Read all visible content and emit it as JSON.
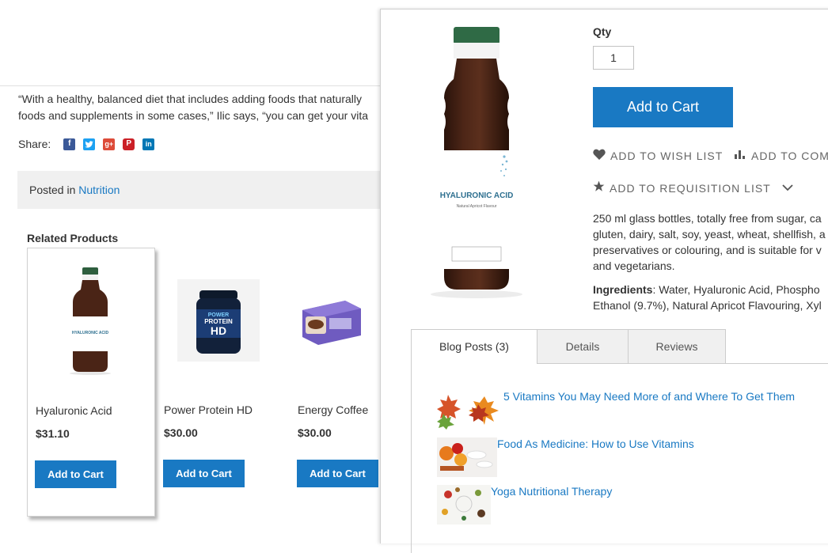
{
  "blog": {
    "quote_line1": "“With a healthy, balanced diet that includes adding foods that naturally",
    "quote_line2": "foods and supplements in some cases,” Ilic says, “you can get your vita",
    "share_label": "Share:",
    "social_icons": [
      "facebook-icon",
      "twitter-icon",
      "google-plus-icon",
      "pinterest-icon",
      "linkedin-icon"
    ],
    "posted_prefix": "Posted in",
    "posted_category": "Nutrition",
    "related_title": "Related Products",
    "products": [
      {
        "name": "Hyaluronic Acid",
        "price": "$31.10",
        "button": "Add to Cart"
      },
      {
        "name": "Power Protein HD",
        "price": "$30.00",
        "button": "Add to Cart"
      },
      {
        "name": "Energy Coffee",
        "price": "$30.00",
        "button": "Add to Cart"
      }
    ]
  },
  "product": {
    "bottle_label": "HYALURONIC ACID",
    "bottle_sublabel": "Natural Apricot Flavour",
    "qty_label": "Qty",
    "qty_value": "1",
    "add_to_cart": "Add to Cart",
    "wish_list": "ADD TO WISH LIST",
    "compare": "ADD TO COM",
    "requisition": "ADD TO REQUISITION LIST",
    "description": [
      "250 ml glass bottles, totally free from sugar, ca",
      "gluten, dairy, salt, soy, yeast, wheat, shellfish, a",
      "preservatives or colouring, and is suitable for v",
      "and vegetarians."
    ],
    "ingredients_label": "Ingredients",
    "ingredients_line1": ": Water, Hyaluronic Acid, Phospho",
    "ingredients_line2": "Ethanol (9.7%), Natural Apricot Flavouring, Xyl"
  },
  "tabs": [
    {
      "label": "Blog Posts (3)",
      "active": true
    },
    {
      "label": "Details",
      "active": false
    },
    {
      "label": "Reviews",
      "active": false
    }
  ],
  "blog_posts": [
    "5 Vitamins You May Need More of and Where To Get Them",
    "Food As Medicine: How to Use Vitamins",
    "Yoga Nutritional Therapy"
  ],
  "colors": {
    "accent": "#1979c3",
    "facebook": "#3b5998",
    "twitter": "#1da1f2",
    "google_plus": "#dd4b39",
    "pinterest": "#cb2027",
    "linkedin": "#0077b5"
  }
}
